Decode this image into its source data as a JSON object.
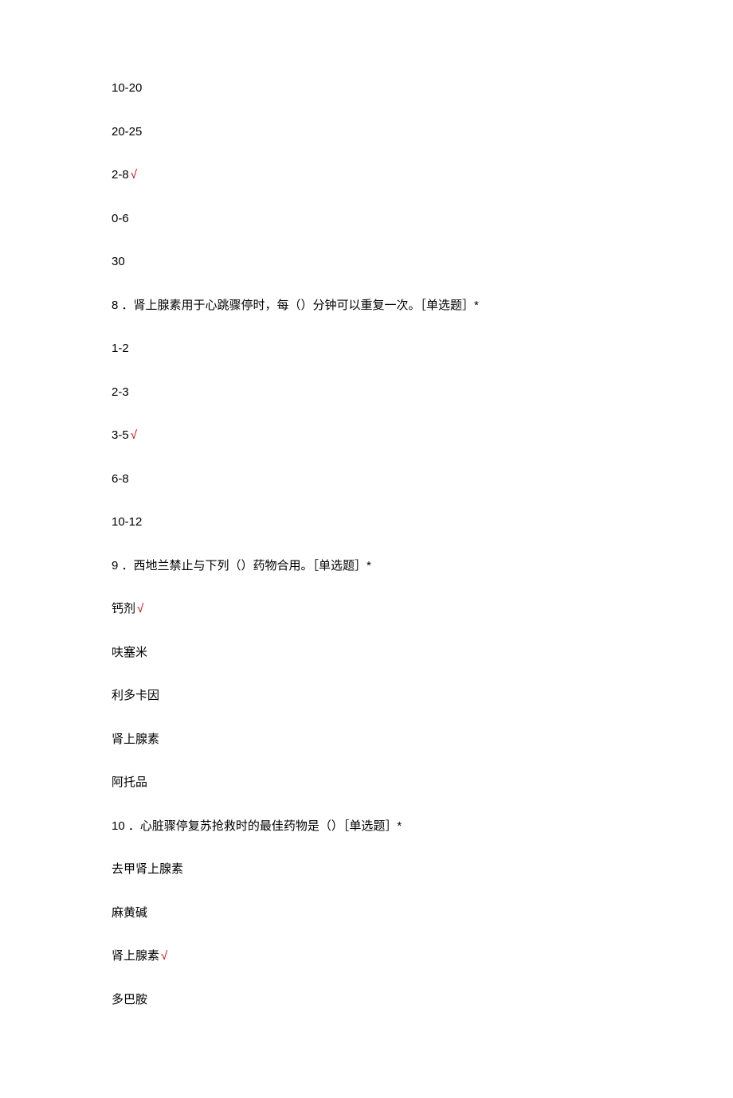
{
  "q7_options": {
    "o1": "10-20",
    "o2": "20-25",
    "o3_text": "2-8",
    "o3_mark": "√",
    "o4": "0-6",
    "o5": "30"
  },
  "q8": {
    "prefix": "8 ．",
    "text": "肾上腺素用于心跳骤停时，每（）分钟可以重复一次。［单选题］*",
    "options": {
      "o1": "1-2",
      "o2": "2-3",
      "o3_text": "3-5",
      "o3_mark": "√",
      "o4": "6-8",
      "o5": "10-12"
    }
  },
  "q9": {
    "prefix": "9 ．",
    "text": "西地兰禁止与下列（）药物合用。［单选题］*",
    "options": {
      "o1_text": "钙剂",
      "o1_mark": "√",
      "o2": "呋塞米",
      "o3": "利多卡因",
      "o4": "肾上腺素",
      "o5": "阿托品"
    }
  },
  "q10": {
    "prefix": "10 ．",
    "text": "心脏骤停复苏抢救时的最佳药物是（）［单选题］*",
    "options": {
      "o1": "去甲肾上腺素",
      "o2": "麻黄碱",
      "o3_text": "肾上腺素",
      "o3_mark": "√",
      "o4": "多巴胺"
    }
  }
}
